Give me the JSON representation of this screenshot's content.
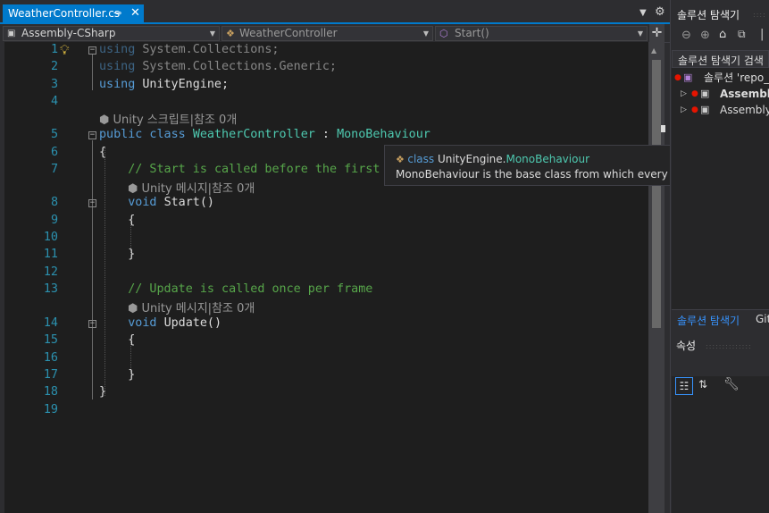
{
  "tab": {
    "title": "WeatherController.cs",
    "pin_icon": "pin-icon",
    "close_icon": "close-icon"
  },
  "window_controls": {
    "dropdown_icon": "dropdown-arrow-icon",
    "settings_icon": "gear-icon"
  },
  "nav": {
    "project": "Assembly-CSharp",
    "class": "WeatherController",
    "member": "Start()"
  },
  "lines": [
    {
      "n": "1",
      "parts": [
        [
          "kw",
          "using"
        ],
        [
          "",
          "System.Collections;"
        ]
      ],
      "faded": true,
      "fold": "-"
    },
    {
      "n": "2",
      "parts": [
        [
          "kw",
          "using"
        ],
        [
          "",
          "System.Collections.Generic;"
        ]
      ],
      "faded": true
    },
    {
      "n": "3",
      "parts": [
        [
          "kw",
          "using"
        ],
        [
          "",
          "UnityEngine;"
        ]
      ]
    },
    {
      "n": "4",
      "parts": []
    },
    {
      "n": "5",
      "parts": [
        [
          "kw",
          "public class "
        ],
        [
          "ty",
          "WeatherController"
        ],
        [
          "",
          " : "
        ],
        [
          "ty",
          "MonoBehaviour"
        ]
      ],
      "fold": "-"
    },
    {
      "n": "6",
      "parts": [
        [
          "",
          "{"
        ]
      ]
    },
    {
      "n": "7",
      "parts": [
        [
          "cm",
          "    // Start is called before the first frame update"
        ]
      ]
    },
    {
      "n": "8",
      "parts": [
        [
          "kw",
          "    void "
        ],
        [
          "",
          "Start()"
        ]
      ],
      "fold": "-"
    },
    {
      "n": "9",
      "parts": [
        [
          "",
          "    {"
        ]
      ]
    },
    {
      "n": "10",
      "parts": []
    },
    {
      "n": "11",
      "parts": [
        [
          "",
          "    }"
        ]
      ]
    },
    {
      "n": "12",
      "parts": []
    },
    {
      "n": "13",
      "parts": [
        [
          "cm",
          "    // Update is called once per frame"
        ]
      ]
    },
    {
      "n": "14",
      "parts": [
        [
          "kw",
          "    void "
        ],
        [
          "",
          "Update()"
        ]
      ],
      "fold": "-"
    },
    {
      "n": "15",
      "parts": [
        [
          "",
          "    {"
        ]
      ]
    },
    {
      "n": "16",
      "parts": []
    },
    {
      "n": "17",
      "parts": [
        [
          "",
          "    }"
        ]
      ]
    },
    {
      "n": "18",
      "parts": [
        [
          "",
          "}"
        ]
      ]
    },
    {
      "n": "19",
      "parts": []
    }
  ],
  "codelens": {
    "class": "Unity 스크립트|참조 0개",
    "start": "Unity 메시지|참조 0개",
    "update": "Unity 메시지|참조 0개"
  },
  "tooltip": {
    "keyword": "class",
    "namespace": "UnityEngine.",
    "type": "MonoBehaviour",
    "description": "MonoBehaviour is the base class from which every Unity script derives."
  },
  "solution_explorer": {
    "title": "솔루션 탐색기",
    "search_placeholder": "솔루션 탐색기 검색",
    "items": [
      {
        "label": "솔루션 'repo_",
        "bold": false
      },
      {
        "label": "Assembly",
        "bold": true
      },
      {
        "label": "Assembly-",
        "bold": false
      }
    ]
  },
  "bottom_tabs": {
    "active": "솔루션 탐색기",
    "other": "Git"
  },
  "properties": {
    "title": "속성"
  },
  "colors": {
    "accent": "#007acc",
    "keyword": "#569cd6",
    "type": "#4ec9b0",
    "comment": "#57a64a",
    "line_number": "#2b91af"
  }
}
